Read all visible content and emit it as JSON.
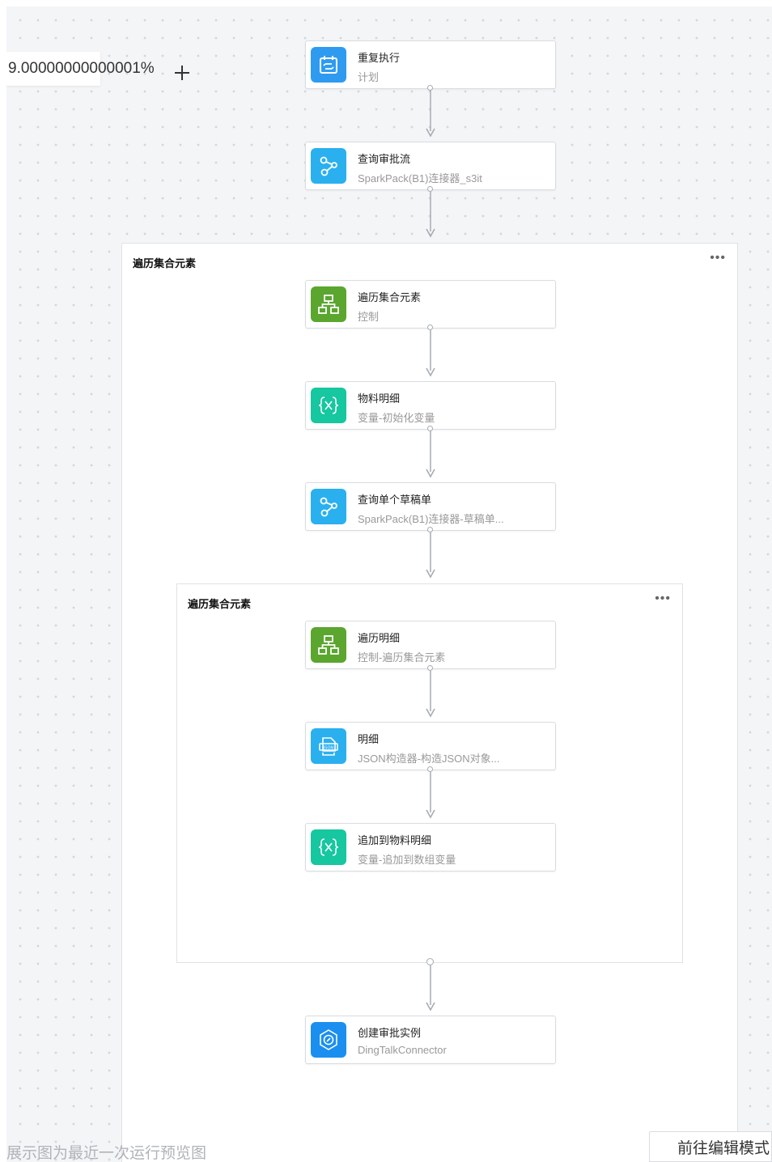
{
  "toolbar": {
    "zoom_value": "9.00000000000001%",
    "zoom_in_icon": "plus-icon"
  },
  "groups": {
    "outer": {
      "title": "遍历集合元素",
      "menu_icon": "more-dots-icon"
    },
    "inner": {
      "title": "遍历集合元素",
      "menu_icon": "more-dots-icon"
    }
  },
  "nodes": [
    {
      "title": "重复执行",
      "subtitle": "计划",
      "icon": "calendar-repeat-icon",
      "color": "#2f9bf0"
    },
    {
      "title": "查询审批流",
      "subtitle": "SparkPack(B1)连接器_s3it",
      "icon": "connector-icon",
      "color": "#2ab0ef"
    },
    {
      "title": "遍历集合元素",
      "subtitle": "控制",
      "icon": "hierarchy-icon",
      "color": "#5aa62e"
    },
    {
      "title": "物料明细",
      "subtitle": "变量-初始化变量",
      "icon": "variable-icon",
      "color": "#16c7a0"
    },
    {
      "title": "查询单个草稿单",
      "subtitle": "SparkPack(B1)连接器-草稿单...",
      "icon": "connector-icon",
      "color": "#2ab0ef"
    },
    {
      "title": "遍历明细",
      "subtitle": "控制-遍历集合元素",
      "icon": "hierarchy-icon",
      "color": "#5aa62e"
    },
    {
      "title": "明细",
      "subtitle": "JSON构造器-构造JSON对象...",
      "icon": "json-builder-icon",
      "color": "#2ab0ef"
    },
    {
      "title": "追加到物料明细",
      "subtitle": "变量-追加到数组变量",
      "icon": "variable-icon",
      "color": "#16c7a0"
    },
    {
      "title": "创建审批实例",
      "subtitle": "DingTalkConnector",
      "icon": "dingtalk-icon",
      "color": "#1a8ff0"
    }
  ],
  "footer": {
    "preview_note": "展示图为最近一次运行预览图",
    "edit_button": "前往编辑模式"
  }
}
